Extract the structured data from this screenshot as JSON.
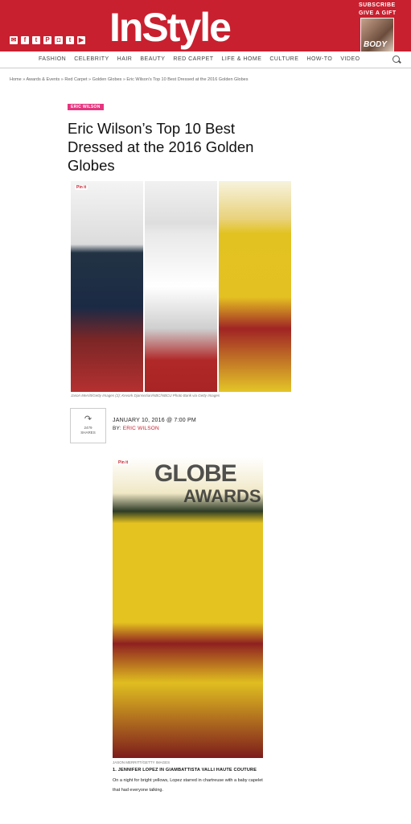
{
  "header": {
    "logo": "InStyle",
    "subscribe": "SUBSCRIBE",
    "give_gift": "GIVE A GIFT",
    "cover_text": "BODY",
    "social_icons": [
      "mail-icon",
      "facebook-icon",
      "twitter-icon",
      "pinterest-icon",
      "instagram-icon",
      "tumblr-icon",
      "youtube-icon"
    ],
    "social_glyphs": [
      "✉",
      "f",
      "t",
      "P",
      "◘",
      "t",
      "▶"
    ]
  },
  "nav": {
    "items": [
      "FASHION",
      "CELEBRITY",
      "HAIR",
      "BEAUTY",
      "RED CARPET",
      "LIFE & HOME",
      "CULTURE",
      "HOW-TO",
      "VIDEO"
    ]
  },
  "breadcrumb": "Home » Awards & Events » Red Carpet » Golden Globes » Eric Wilson's Top 10 Best Dressed at the 2016 Golden Globes",
  "article": {
    "tag": "ERIC WILSON",
    "title": "Eric Wilson’s Top 10 Best Dressed at the 2016 Golden Globes",
    "pin_label": "Pin it",
    "hero_caption": "Jason Merritt/Getty Images (2); Kevork Djansezian/NBC/NBCU Photo Bank via Getty Images",
    "share_count": "2479",
    "share_label": "SHARES",
    "date": "JANUARY 10, 2016 @ 7:00 PM",
    "by_label": "BY: ",
    "author": "ERIC WILSON"
  },
  "slide": {
    "photo_text_1": "GLOBE",
    "photo_text_2": "AWARDS",
    "credit": "JASON MERRITT/GETTY IMAGES",
    "heading": "1. JENNIFER LOPEZ IN GIAMBATTISTA VALLI HAUTE COUTURE",
    "description": "On a night for bright yellows, Lopez starred in chartreuse with a baby capelet that had everyone talking."
  },
  "colors": {
    "brand_red": "#c8202f",
    "tag_pink": "#e8347f"
  }
}
